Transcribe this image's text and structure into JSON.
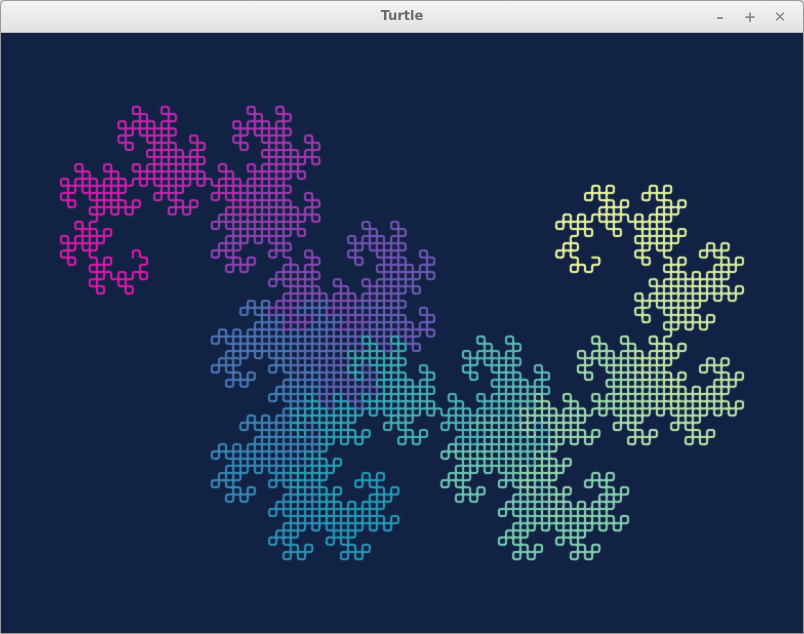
{
  "window": {
    "title": "Turtle",
    "minimize_glyph": "–",
    "maximize_glyph": "+",
    "close_glyph": "✕"
  },
  "canvas": {
    "background": "#112244",
    "drawing": "dragon-curve",
    "iterations": 12,
    "palette": [
      "#fbffa2",
      "#90dcb6",
      "#23a1bd",
      "#7a55b8",
      "#e617ae"
    ]
  }
}
